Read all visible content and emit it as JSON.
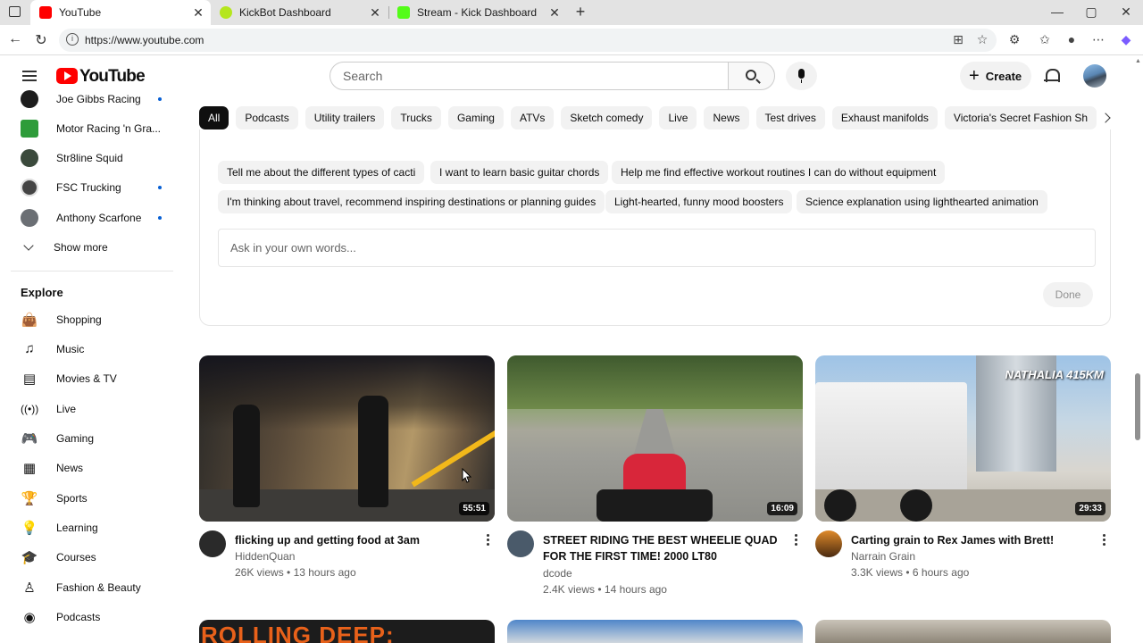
{
  "browser": {
    "tabs": [
      {
        "title": "YouTube",
        "active": true,
        "favicon_color": "#ff0000"
      },
      {
        "title": "KickBot Dashboard",
        "active": false,
        "favicon_color": "#b5e61d"
      },
      {
        "title": "Stream - Kick Dashboard",
        "active": false,
        "favicon_color": "#53fc18"
      }
    ],
    "url": "https://www.youtube.com"
  },
  "header": {
    "logo_text": "YouTube",
    "search_placeholder": "Search",
    "create_label": "Create"
  },
  "sidebar": {
    "subscriptions": [
      {
        "name": "Joe Gibbs Racing",
        "new": true
      },
      {
        "name": "Motor Racing 'n Gra...",
        "new": false
      },
      {
        "name": "Str8line Squid",
        "new": false
      },
      {
        "name": "FSC Trucking",
        "new": true
      },
      {
        "name": "Anthony Scarfone",
        "new": true
      }
    ],
    "show_more": "Show more",
    "explore_title": "Explore",
    "explore": [
      {
        "label": "Shopping",
        "icon": "shopping-bag-icon"
      },
      {
        "label": "Music",
        "icon": "music-note-icon"
      },
      {
        "label": "Movies & TV",
        "icon": "clapperboard-icon"
      },
      {
        "label": "Live",
        "icon": "live-broadcast-icon"
      },
      {
        "label": "Gaming",
        "icon": "gamepad-icon"
      },
      {
        "label": "News",
        "icon": "newspaper-icon"
      },
      {
        "label": "Sports",
        "icon": "trophy-icon"
      },
      {
        "label": "Learning",
        "icon": "lightbulb-icon"
      },
      {
        "label": "Courses",
        "icon": "graduation-cap-icon"
      },
      {
        "label": "Fashion & Beauty",
        "icon": "hanger-icon"
      },
      {
        "label": "Podcasts",
        "icon": "podcast-icon"
      }
    ]
  },
  "chips": [
    "All",
    "Podcasts",
    "Utility trailers",
    "Trucks",
    "Gaming",
    "ATVs",
    "Sketch comedy",
    "Live",
    "News",
    "Test drives",
    "Exhaust manifolds",
    "Victoria's Secret Fashion Sh"
  ],
  "ask": {
    "suggestions_row1": [
      "Tell me about the different types of cacti",
      "I want to learn basic guitar chords",
      "Help me find effective workout routines I can do without equipment"
    ],
    "suggestions_row2": [
      "I'm thinking about travel, recommend inspiring destinations or planning guides",
      "Light-hearted, funny mood boosters",
      "Science explanation using lighthearted animation"
    ],
    "input_placeholder": "Ask in your own words...",
    "done_label": "Done"
  },
  "videos": [
    {
      "title": "flicking up and getting food at 3am",
      "channel": "HiddenQuan",
      "views": "26K views",
      "age": "13 hours ago",
      "duration": "55:51"
    },
    {
      "title": "STREET RIDING THE BEST WHEELIE QUAD FOR THE FIRST TIME! 2000 LT80",
      "channel": "dcode",
      "views": "2.4K views",
      "age": "14 hours ago",
      "duration": "16:09"
    },
    {
      "title": "Carting grain to Rex James with Brett!",
      "channel": "Narrain Grain",
      "views": "3.3K views",
      "age": "6 hours ago",
      "duration": "29:33",
      "overlay_text": "NATHALIA 415KM"
    }
  ],
  "partial_row": {
    "first_thumb_text": "ROLLING DEEP:"
  }
}
